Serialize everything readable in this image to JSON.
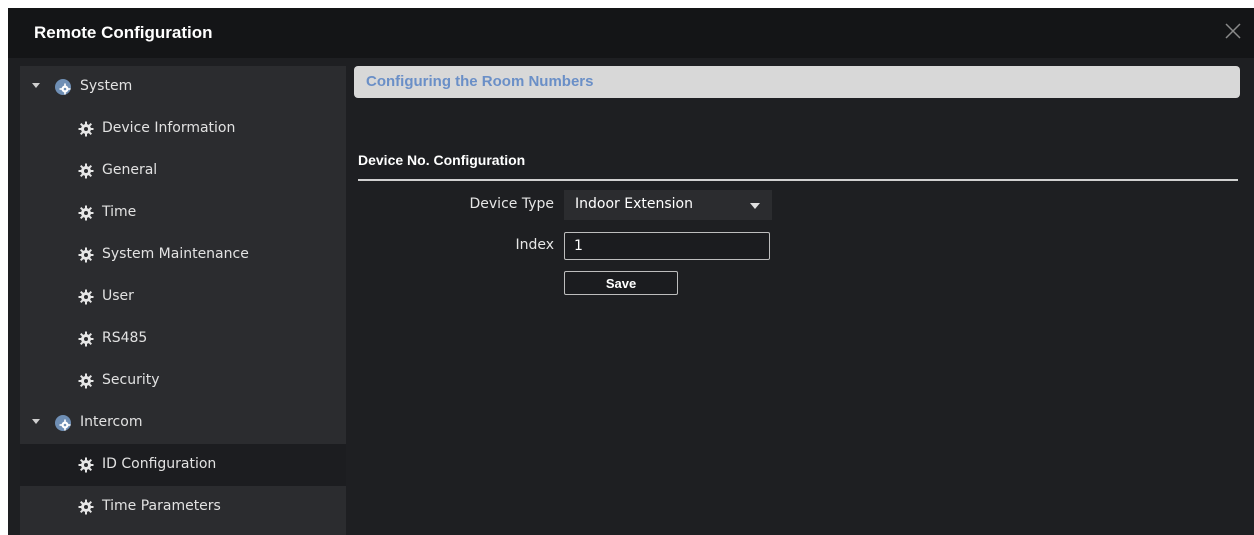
{
  "window": {
    "title": "Remote Configuration",
    "close_icon": "close-icon"
  },
  "sidebar": {
    "groups": [
      {
        "label": "System",
        "icon": "gear-group-icon",
        "expanded": true,
        "items": [
          {
            "label": "Device Information",
            "icon": "gear-icon"
          },
          {
            "label": "General",
            "icon": "gear-icon"
          },
          {
            "label": "Time",
            "icon": "gear-icon"
          },
          {
            "label": "System Maintenance",
            "icon": "gear-icon"
          },
          {
            "label": "User",
            "icon": "gear-icon"
          },
          {
            "label": "RS485",
            "icon": "gear-icon"
          },
          {
            "label": "Security",
            "icon": "gear-icon"
          }
        ]
      },
      {
        "label": "Intercom",
        "icon": "gear-group-icon",
        "expanded": true,
        "items": [
          {
            "label": "ID Configuration",
            "icon": "gear-icon",
            "selected": true
          },
          {
            "label": "Time Parameters",
            "icon": "gear-icon"
          }
        ]
      }
    ]
  },
  "main": {
    "section_title": "Configuring the Room Numbers",
    "subheading": "Device No. Configuration",
    "form": {
      "device_type_label": "Device Type",
      "device_type_value": "Indoor Extension",
      "index_label": "Index",
      "index_value": "1",
      "save_label": "Save"
    }
  },
  "colors": {
    "title_bar": "#141517",
    "background": "#1e1f22",
    "sidebar": "#2b2c2f",
    "selected_row": "#1c1d20",
    "section_header_bg": "#d8d8d8",
    "section_header_text": "#6a8fc7"
  }
}
